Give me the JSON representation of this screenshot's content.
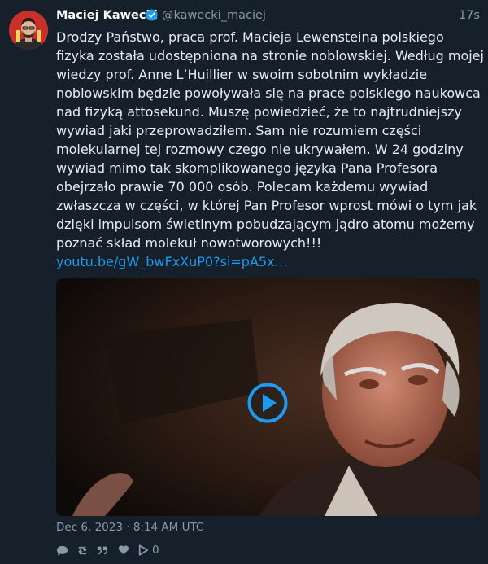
{
  "author": {
    "name": "Maciej Kawecki",
    "handle": "@kawecki_maciej",
    "verified_icon": "verified-badge-icon"
  },
  "tweet": {
    "time": "17s",
    "text": "Drodzy Państwo, praca prof. Macieja Lewensteina polskiego fizyka została udostępniona na stronie noblowskiej. Według mojej wiedzy prof. Anne L’Huillier w swoim sobotnim wykładzie noblowskim będzie powoływała się na prace polskiego naukowca nad fizyką attosekund. Muszę powiedzieć, że to najtrudniejszy wywiad jaki przeprowadziłem. Sam nie rozumiem części molekularnej tej rozmowy czego nie ukrywałem. W 24 godziny wywiad mimo tak skomplikowanego języka Pana Profesora obejrzało prawie 70 000 osób. Polecam każdemu wywiad zwłaszcza w części, w której Pan Profesor wprost mówi o tym jak dzięki impulsom świetlnym pobudzającym jądro atomu możemy poznać skład molekuł nowotworowych!!!",
    "link": "youtu.be/gW_bwFxXuP0?si=pA5x…",
    "date": "Dec 6, 2023 · 8:14 AM UTC"
  },
  "media": {
    "type": "video",
    "play_icon": "play-icon"
  },
  "actions": {
    "reply_icon": "reply-icon",
    "retweet_icon": "retweet-icon",
    "quote_icon": "quote-icon",
    "like_icon": "heart-icon",
    "views_icon": "play-icon",
    "views_count": "0"
  },
  "colors": {
    "background": "#15202b",
    "accent": "#1d9bf0",
    "muted": "#8b98a5"
  }
}
